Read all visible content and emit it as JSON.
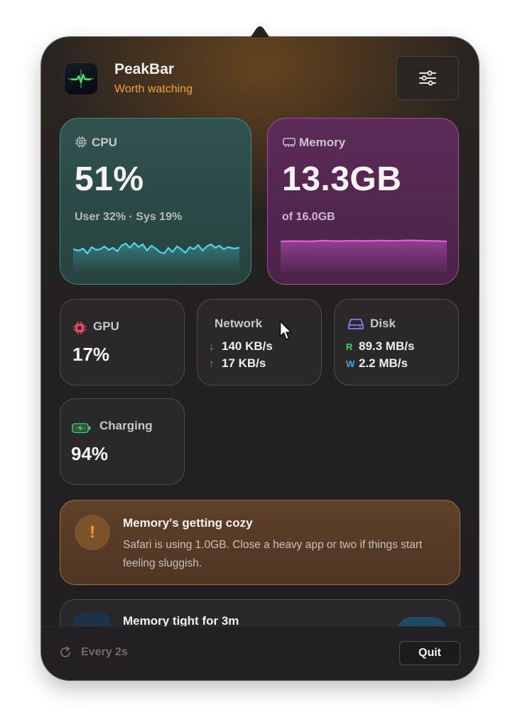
{
  "header": {
    "app_name": "PeakBar",
    "status": "Worth watching",
    "status_color": "#f3a13a",
    "app_icon": "peakbar-logo-icon",
    "settings_icon": "sliders-icon"
  },
  "cpu": {
    "label": "CPU",
    "icon": "chip-icon",
    "value": "51%",
    "breakdown": "User 32% · Sys 19%",
    "accent": "#4fd6e8"
  },
  "memory": {
    "label": "Memory",
    "icon": "memory-icon",
    "value": "13.3GB",
    "total": "of 16.0GB",
    "accent": "#e35be0"
  },
  "gpu": {
    "label": "GPU",
    "icon": "gpu-icon",
    "value": "17%",
    "accent": "#e8466e"
  },
  "network": {
    "label": "Network",
    "download": "140 KB/s",
    "upload": "17 KB/s",
    "download_color": "#3fd26a",
    "upload_color": "#3aa6e8"
  },
  "disk": {
    "label": "Disk",
    "icon": "disk-icon",
    "read_marker": "R",
    "read": "89.3 MB/s",
    "write_marker": "W",
    "write": "2.2 MB/s",
    "read_color": "#3fd26a",
    "write_color": "#3aa6e8",
    "accent": "#8b7cf0"
  },
  "battery": {
    "label": "Charging",
    "icon": "battery-charging-icon",
    "value": "94%",
    "accent": "#3fd26a"
  },
  "alert": {
    "badge": "!",
    "title": "Memory's getting cozy",
    "body": "Safari is using 1.0GB. Close a heavy app or two if things start feeling sluggish.",
    "accent": "#f39a30"
  },
  "history": {
    "title": "Memory tight for 3m"
  },
  "footer": {
    "refresh_icon": "refresh-icon",
    "refresh_label": "Every 2s",
    "quit_label": "Quit"
  }
}
